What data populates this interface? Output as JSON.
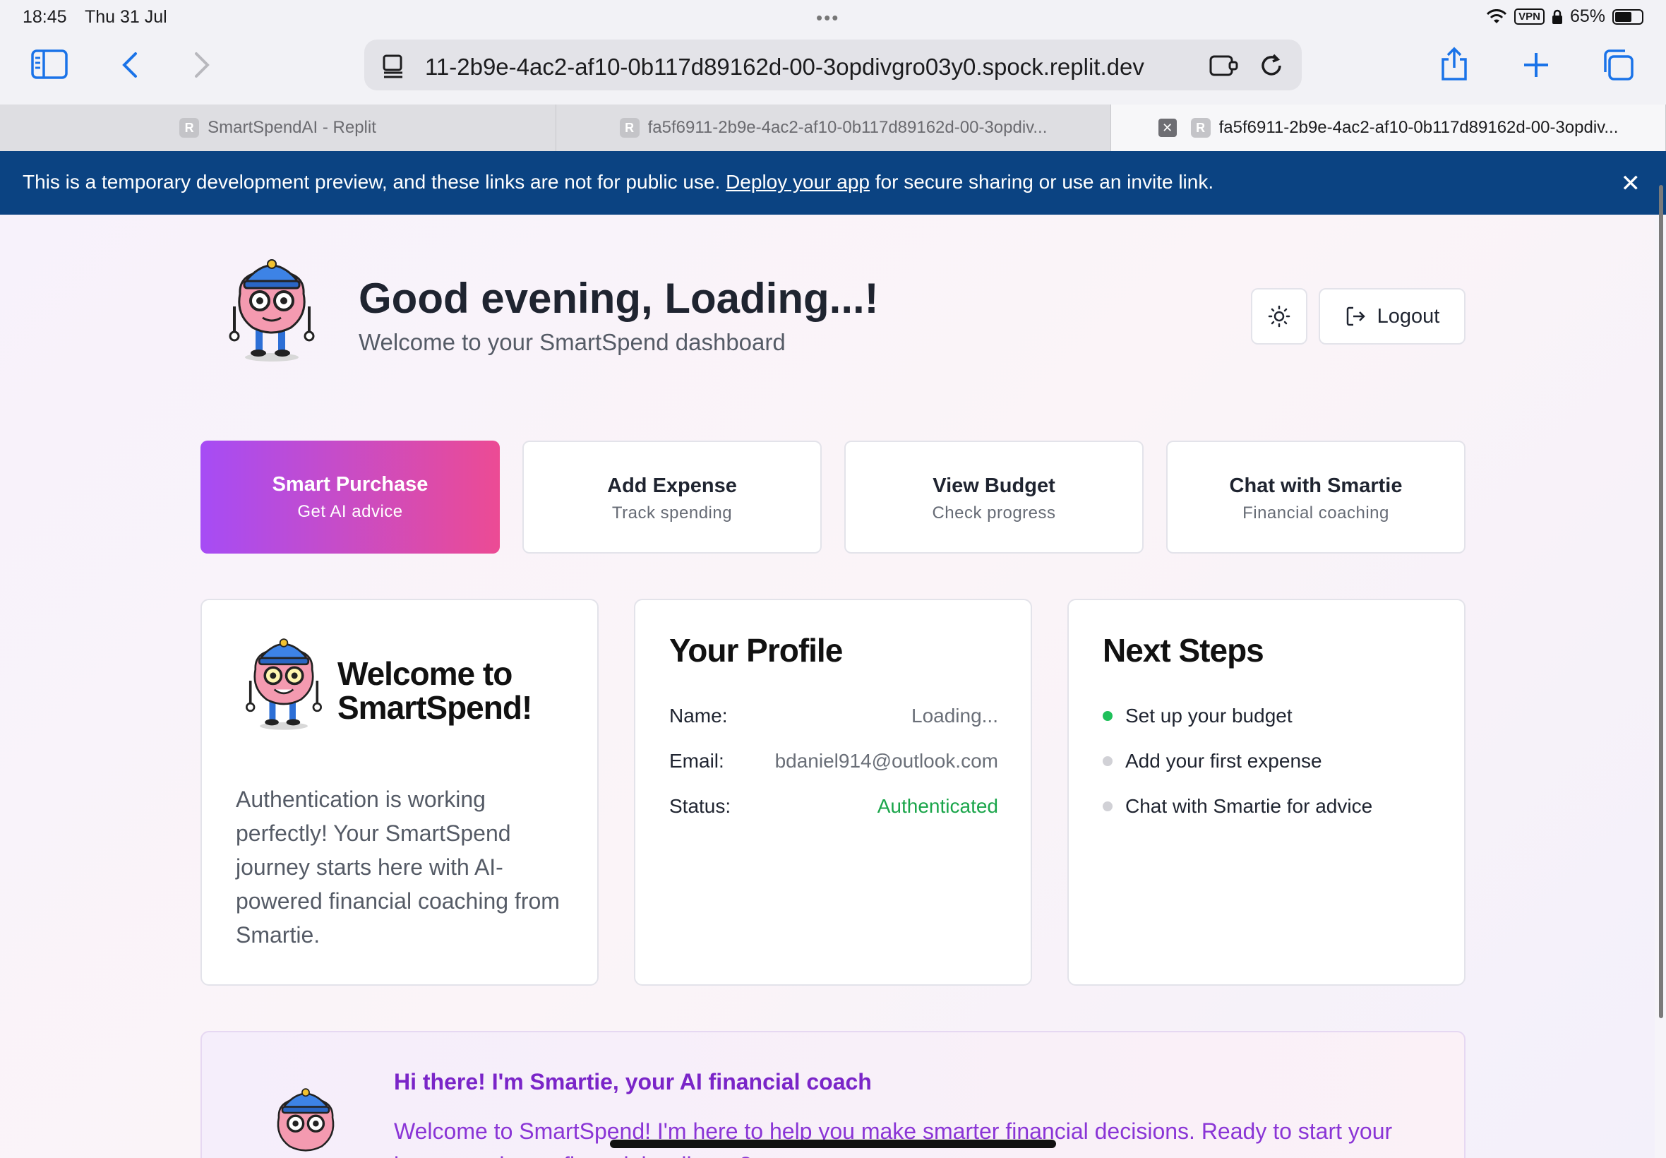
{
  "status_bar": {
    "time": "18:45",
    "date": "Thu 31 Jul",
    "vpn": "VPN",
    "battery": "65%",
    "battery_level": 0.65
  },
  "browser": {
    "url": "11-2b9e-4ac2-af10-0b117d89162d-00-3opdivgro03y0.spock.replit.dev",
    "tabs": [
      {
        "label": "SmartSpendAI - Replit",
        "favicon": "R"
      },
      {
        "label": "fa5f6911-2b9e-4ac2-af10-0b117d89162d-00-3opdiv...",
        "favicon": "R"
      },
      {
        "label": "fa5f6911-2b9e-4ac2-af10-0b117d89162d-00-3opdiv...",
        "favicon": "R",
        "active": true
      }
    ]
  },
  "banner": {
    "text_before": "This is a temporary development preview, and these links are not for public use. ",
    "link": "Deploy your app",
    "text_after": " for secure sharing or use an invite link."
  },
  "header": {
    "greeting": "Good evening, Loading...!",
    "subtitle": "Welcome to your SmartSpend dashboard",
    "logout": "Logout"
  },
  "actions": [
    {
      "title": "Smart Purchase",
      "subtitle": "Get AI advice"
    },
    {
      "title": "Add Expense",
      "subtitle": "Track spending"
    },
    {
      "title": "View Budget",
      "subtitle": "Check progress"
    },
    {
      "title": "Chat with Smartie",
      "subtitle": "Financial coaching"
    }
  ],
  "welcome_card": {
    "title_line1": "Welcome to",
    "title_line2": "SmartSpend!",
    "body": "Authentication is working perfectly! Your SmartSpend journey starts here with AI-powered financial coaching from Smartie."
  },
  "profile_card": {
    "title": "Your Profile",
    "rows": [
      {
        "key": "Name:",
        "value": "Loading..."
      },
      {
        "key": "Email:",
        "value": "bdaniel914@outlook.com"
      },
      {
        "key": "Status:",
        "value": "Authenticated"
      }
    ]
  },
  "next_steps": {
    "title": "Next Steps",
    "items": [
      "Set up your budget",
      "Add your first expense",
      "Chat with Smartie for advice"
    ]
  },
  "chat": {
    "heading": "Hi there! I'm Smartie, your AI financial coach",
    "text": "Welcome to SmartSpend! I'm here to help you make smarter financial decisions. Ready to start your journey to better financial wellness?"
  },
  "colors": {
    "banner": "#0b4382",
    "accent_start": "#a64cf5",
    "accent_end": "#ec4b94",
    "success": "#1aa54a",
    "chat_text": "#8a35d6"
  }
}
